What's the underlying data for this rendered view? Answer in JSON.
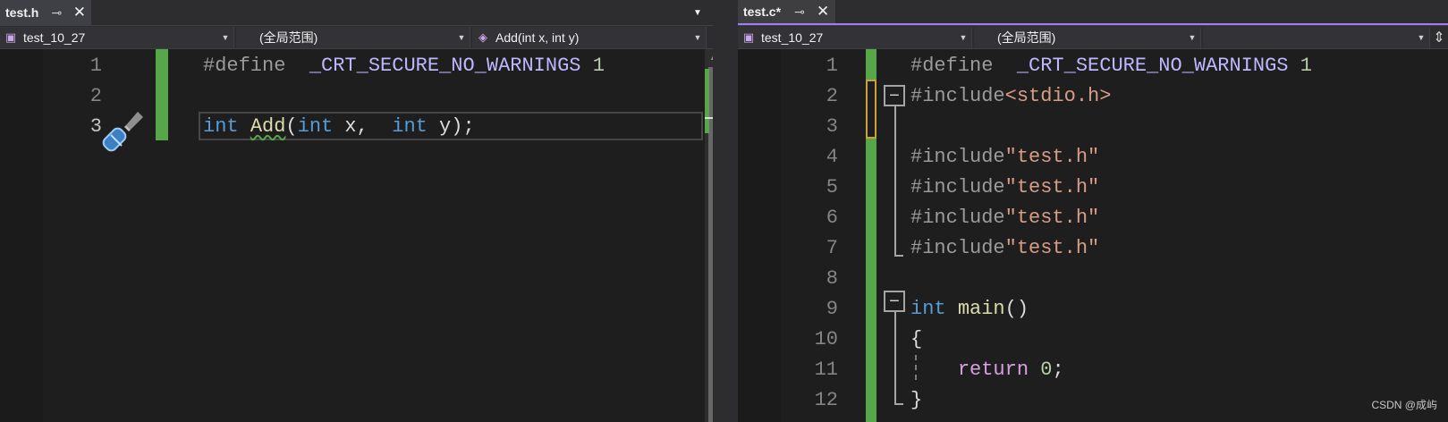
{
  "left_editor": {
    "tab": {
      "name": "test.h",
      "pin_icon": "pin-icon",
      "close_icon": "close-icon"
    },
    "overflow_icon": "dropdown-arrow-icon",
    "settings_icon": "gear-icon",
    "nav": {
      "project": "test_10_27",
      "scope": "(全局范围)",
      "member": "Add(int x, int y)"
    },
    "split_icon": "split-editor-icon",
    "gutter_icon": "quick-actions-screwdriver-icon",
    "line_numbers": [
      "1",
      "2",
      "3"
    ],
    "lines": [
      {
        "tokens": [
          {
            "t": "#define",
            "c": "tk-pre"
          },
          {
            "t": "  ",
            "c": "tk-plain"
          },
          {
            "t": "_CRT_SECURE_NO_WARNINGS",
            "c": "tk-macro"
          },
          {
            "t": " ",
            "c": "tk-plain"
          },
          {
            "t": "1",
            "c": "tk-num"
          }
        ]
      },
      {
        "tokens": []
      },
      {
        "tokens": [
          {
            "t": "int",
            "c": "tk-kw"
          },
          {
            "t": " ",
            "c": "tk-plain"
          },
          {
            "t": "Add",
            "c": "tk-fn tk-squiggle"
          },
          {
            "t": "(",
            "c": "tk-plain"
          },
          {
            "t": "int",
            "c": "tk-kw"
          },
          {
            "t": " x,  ",
            "c": "tk-plain"
          },
          {
            "t": "int",
            "c": "tk-kw"
          },
          {
            "t": " y);",
            "c": "tk-plain"
          }
        ]
      }
    ]
  },
  "right_editor": {
    "tab": {
      "name": "test.c*",
      "pin_icon": "pin-icon",
      "close_icon": "close-icon"
    },
    "nav": {
      "project": "test_10_27",
      "scope": "(全局范围)",
      "member": ""
    },
    "split_icon": "split-editor-icon",
    "line_numbers": [
      "1",
      "2",
      "3",
      "4",
      "5",
      "6",
      "7",
      "8",
      "9",
      "10",
      "11",
      "12"
    ],
    "lines": [
      {
        "tokens": [
          {
            "t": "#define",
            "c": "tk-pre"
          },
          {
            "t": "  ",
            "c": "tk-plain"
          },
          {
            "t": "_CRT_SECURE_NO_WARNINGS",
            "c": "tk-macro"
          },
          {
            "t": " ",
            "c": "tk-plain"
          },
          {
            "t": "1",
            "c": "tk-num"
          }
        ]
      },
      {
        "tokens": [
          {
            "t": "#include",
            "c": "tk-pre"
          },
          {
            "t": "<stdio.h>",
            "c": "tk-str"
          }
        ]
      },
      {
        "tokens": []
      },
      {
        "tokens": [
          {
            "t": "#include",
            "c": "tk-pre"
          },
          {
            "t": "\"test.h\"",
            "c": "tk-str"
          }
        ]
      },
      {
        "tokens": [
          {
            "t": "#include",
            "c": "tk-pre"
          },
          {
            "t": "\"test.h\"",
            "c": "tk-str"
          }
        ]
      },
      {
        "tokens": [
          {
            "t": "#include",
            "c": "tk-pre"
          },
          {
            "t": "\"test.h\"",
            "c": "tk-str"
          }
        ]
      },
      {
        "tokens": [
          {
            "t": "#include",
            "c": "tk-pre"
          },
          {
            "t": "\"test.h\"",
            "c": "tk-str"
          }
        ]
      },
      {
        "tokens": []
      },
      {
        "tokens": [
          {
            "t": "int",
            "c": "tk-kw"
          },
          {
            "t": " ",
            "c": "tk-plain"
          },
          {
            "t": "main",
            "c": "tk-fn"
          },
          {
            "t": "()",
            "c": "tk-plain"
          }
        ]
      },
      {
        "tokens": [
          {
            "t": "{",
            "c": "tk-plain"
          }
        ]
      },
      {
        "tokens": [
          {
            "t": "    ",
            "c": "tk-plain"
          },
          {
            "t": "return",
            "c": "tk-ctrl"
          },
          {
            "t": " ",
            "c": "tk-plain"
          },
          {
            "t": "0",
            "c": "tk-num"
          },
          {
            "t": ";",
            "c": "tk-plain"
          }
        ]
      },
      {
        "tokens": [
          {
            "t": "}",
            "c": "tk-plain"
          }
        ]
      }
    ],
    "fold_symbols": [
      "−",
      "−"
    ]
  },
  "watermark": "CSDN @成屿",
  "colors": {
    "change_bar": "#57a64a",
    "active_tab_accent": "#9e7ef2",
    "saved_marker": "#c9a33a"
  }
}
